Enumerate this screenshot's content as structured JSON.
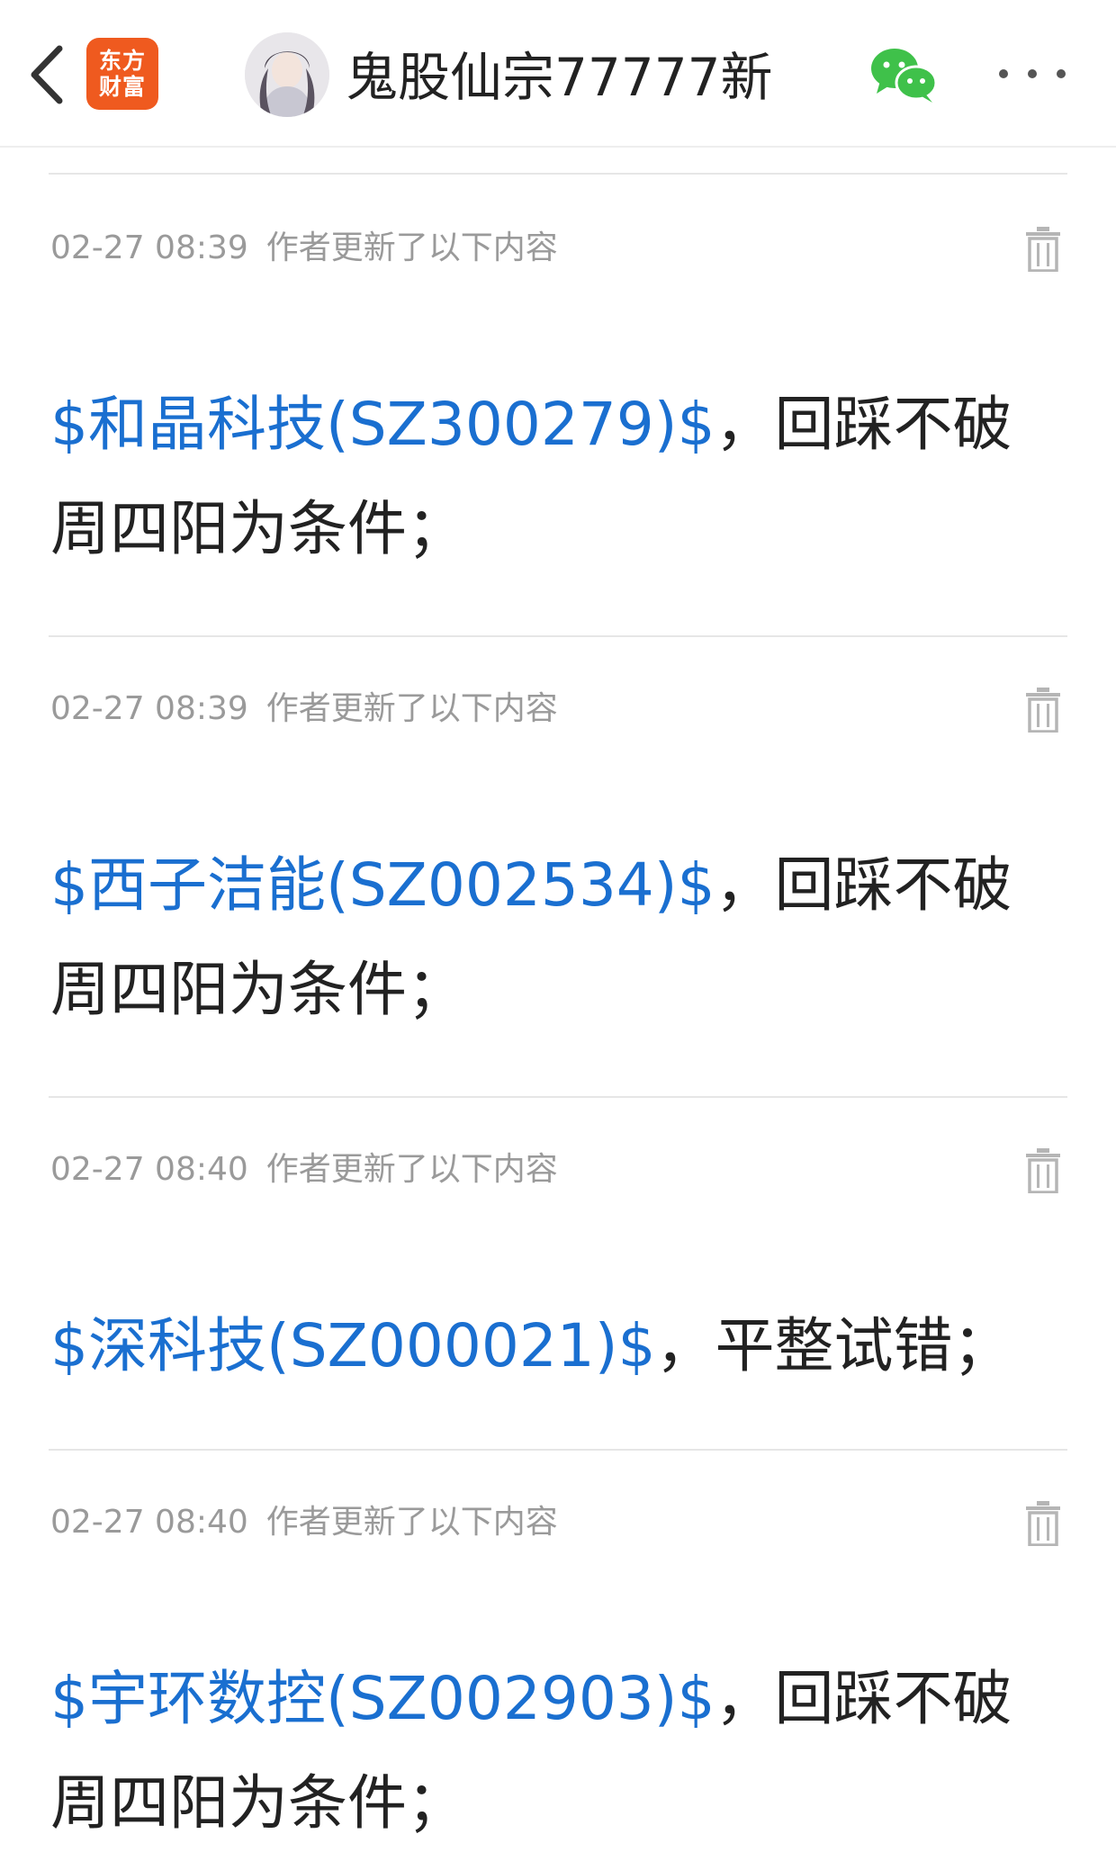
{
  "header": {
    "back_icon": "chevron-left-icon",
    "logo_line1": "东方",
    "logo_line2": "财富",
    "title": "鬼股仙宗77777新",
    "share_icon": "wechat-icon",
    "more_icon": "more-dots-icon"
  },
  "colors": {
    "link": "#1a6fd0",
    "logo": "#ef5a1f",
    "wechat": "#3fc14a"
  },
  "updates": [
    {
      "time": "02-27 08:39",
      "label": "作者更新了以下内容",
      "stock": "$和晶科技(SZ300279)$",
      "text": "，回踩不破周四阳为条件；"
    },
    {
      "time": "02-27 08:39",
      "label": "作者更新了以下内容",
      "stock": "$西子洁能(SZ002534)$",
      "text": "，回踩不破周四阳为条件；"
    },
    {
      "time": "02-27 08:40",
      "label": "作者更新了以下内容",
      "stock": "$深科技(SZ000021)$",
      "text": "，平整试错；"
    },
    {
      "time": "02-27 08:40",
      "label": "作者更新了以下内容",
      "stock": "$宇环数控(SZ002903)$",
      "text": "，回踩不破周四阳为条件；"
    }
  ]
}
